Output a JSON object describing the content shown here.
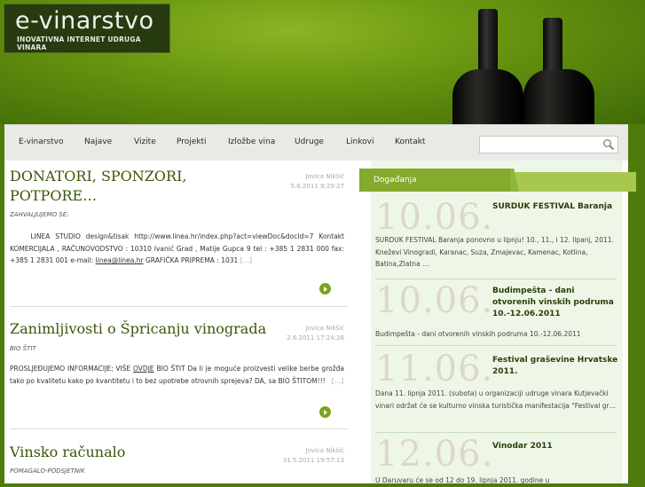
{
  "header": {
    "logo_title": "e-vinarstvo",
    "logo_subtitle": "INOVATIVNA INTERNET UDRUGA VINARA"
  },
  "nav": {
    "items": [
      "E-vinarstvo",
      "Najave",
      "Vizite",
      "Projekti",
      "Izložbe vina",
      "Udruge",
      "Linkovi",
      "Kontakt"
    ],
    "search_placeholder": ""
  },
  "posts": [
    {
      "title_line1": "DONATORI, SPONZORI,",
      "title_line2": "POTPORE…",
      "author": "Jovica Nikšić",
      "date": "5.6.2011 9:29:27",
      "category": "ZAHVALJUJEMO SE:",
      "text": "LINEA STUDIO design&tisak http://www.linea.hr/index.php?act=viewDoc&docId=7 Kontakt KOMERCIJALA , RAČUNOVODSTVO : 10310 Ivanić Grad , Matije Gupca 9 tel : +385 1 2831 000 fax: +385 1 2831 001 e-mail: ",
      "email": "linea@linea.hr",
      "text_after": " GRAFIČKA PRIPREMA : 1031",
      "more": "[…]"
    },
    {
      "title": "Zanimljivosti o Špricanju vinograda",
      "author": "Jovica Nikšić",
      "date": "2.6.2011 17:24:28",
      "category": "BIO ŠTIT",
      "text_before": "PROSLJEĐUJEMO INFORMACIJE; VIŠE ",
      "link": "OVDJE",
      "text_after": "  BIO ŠTIT  Da li je moguće proizvesti velike berbe grožđa tako po kvalitetu kako po kvantitetu i to bez upotrebe otrovnih sprejeva? DA, sa BIO ŠTITOM!!!",
      "more": "[…]"
    },
    {
      "title": "Vinsko računalo",
      "author": "Jovica Nikšić",
      "date": "31.5.2011 19:57:13",
      "category": "POMAGALO-PODSJETNIK"
    }
  ],
  "events": {
    "heading": "Događanja",
    "items": [
      {
        "date": "10.06.",
        "title": "SURDUK FESTIVAL Baranja",
        "text": "SURDUK FESTIVAL Baranja ponovno u lipnju! 10., 11., i 12. lipanj, 2011. Kneževi Vinogradi, Karanac, Suza, Zmajevac, Kamenac, Kotlina, Batina,Zlatna …"
      },
      {
        "date": "10.06.",
        "title": "Budimpešta - dani otvorenih vinskih podruma 10.-12.06.2011",
        "text": "Budimpešta - dani otvorenih vinskih podruma 10.-12.06.2011"
      },
      {
        "date": "11.06.",
        "title": "Festival graševine Hrvatske 2011.",
        "text": "Dana 11. lipnja 2011. (subota) u organizaciji udruge vinara Kutjevački vinari održat će se kulturno vinska turistička manifestacija \"Festival gr…"
      },
      {
        "date": "12.06.",
        "title": "Vinodar 2011",
        "text": "U Daruvaru će se od 12 do 19. lipnja 2011. godine u"
      }
    ]
  },
  "colors": {
    "accent": "#84aa2e",
    "title_green": "#3a5706",
    "sidebar_bg": "#eef7e7"
  }
}
